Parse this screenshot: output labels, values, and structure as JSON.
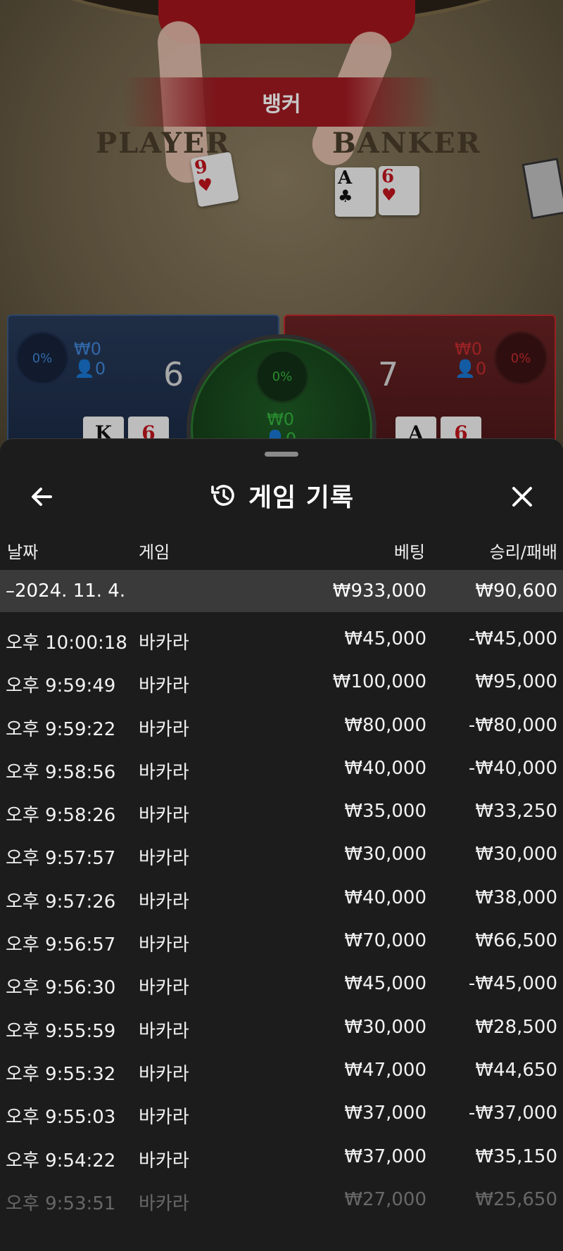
{
  "table": {
    "result_banner": "뱅커",
    "player_label": "PLAYER",
    "banker_label": "BANKER",
    "player_cards": [
      {
        "rank": "9",
        "suit": "♥",
        "color": "red"
      }
    ],
    "banker_cards": [
      {
        "rank": "A",
        "suit": "♣",
        "color": "black"
      },
      {
        "rank": "6",
        "suit": "♥",
        "color": "red"
      }
    ],
    "player_bet": {
      "percent": "0%",
      "amount": "₩0",
      "users": "0",
      "score": "6",
      "cards": [
        "K",
        "6"
      ]
    },
    "tie_bet": {
      "percent": "0%",
      "amount": "₩0",
      "users": "0"
    },
    "banker_bet": {
      "percent": "0%",
      "amount": "₩0",
      "users": "0",
      "score": "7",
      "cards": [
        "A",
        "6"
      ]
    },
    "colors": {
      "player": "#3f86d8",
      "banker": "#c62c30",
      "tie": "#35b43e"
    }
  },
  "history": {
    "title": "게임 기록",
    "icons": {
      "back": "arrow-left-icon",
      "history": "history-clock-icon",
      "close": "close-icon"
    },
    "columns": {
      "date": "날짜",
      "game": "게임",
      "bet": "베팅",
      "win_loss": "승리/패배"
    },
    "date_group": {
      "label": "–2024. 11. 4.",
      "bet_total": "₩933,000",
      "win_loss_total": "₩90,600"
    },
    "rows": [
      {
        "time": "오후 10:00:18",
        "game": "바카라",
        "bet": "₩45,000",
        "win_loss": "-₩45,000"
      },
      {
        "time": "오후 9:59:49",
        "game": "바카라",
        "bet": "₩100,000",
        "win_loss": "₩95,000"
      },
      {
        "time": "오후 9:59:22",
        "game": "바카라",
        "bet": "₩80,000",
        "win_loss": "-₩80,000"
      },
      {
        "time": "오후 9:58:56",
        "game": "바카라",
        "bet": "₩40,000",
        "win_loss": "-₩40,000"
      },
      {
        "time": "오후 9:58:26",
        "game": "바카라",
        "bet": "₩35,000",
        "win_loss": "₩33,250"
      },
      {
        "time": "오후 9:57:57",
        "game": "바카라",
        "bet": "₩30,000",
        "win_loss": "₩30,000"
      },
      {
        "time": "오후 9:57:26",
        "game": "바카라",
        "bet": "₩40,000",
        "win_loss": "₩38,000"
      },
      {
        "time": "오후 9:56:57",
        "game": "바카라",
        "bet": "₩70,000",
        "win_loss": "₩66,500"
      },
      {
        "time": "오후 9:56:30",
        "game": "바카라",
        "bet": "₩45,000",
        "win_loss": "-₩45,000"
      },
      {
        "time": "오후 9:55:59",
        "game": "바카라",
        "bet": "₩30,000",
        "win_loss": "₩28,500"
      },
      {
        "time": "오후 9:55:32",
        "game": "바카라",
        "bet": "₩47,000",
        "win_loss": "₩44,650"
      },
      {
        "time": "오후 9:55:03",
        "game": "바카라",
        "bet": "₩37,000",
        "win_loss": "-₩37,000"
      },
      {
        "time": "오후 9:54:22",
        "game": "바카라",
        "bet": "₩37,000",
        "win_loss": "₩35,150"
      },
      {
        "time": "오후 9:53:51",
        "game": "바카라",
        "bet": "₩27,000",
        "win_loss": "₩25,650"
      }
    ]
  }
}
